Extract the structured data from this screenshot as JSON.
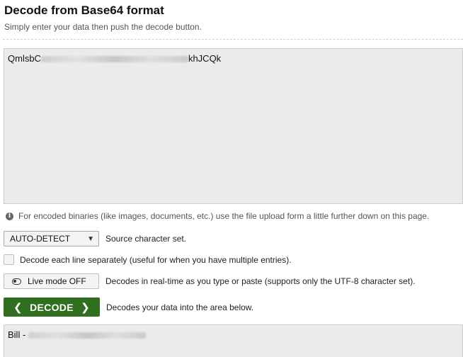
{
  "header": {
    "title": "Decode from Base64 format",
    "subtitle": "Simply enter your data then push the decode button."
  },
  "input": {
    "visible_start": "QmlsbC",
    "visible_end": "khJCQk"
  },
  "info": {
    "icon": "info-icon",
    "text": "For encoded binaries (like images, documents, etc.) use the file upload form a little further down on this page."
  },
  "charset": {
    "selected": "AUTO-DETECT",
    "label": "Source character set."
  },
  "each_line": {
    "checked": false,
    "label": "Decode each line separately (useful for when you have multiple entries)."
  },
  "live_mode": {
    "button_label": "Live mode OFF",
    "description": "Decodes in real-time as you type or paste (supports only the UTF-8 character set)."
  },
  "decode": {
    "button_label": "DECODE",
    "description": "Decodes your data into the area below."
  },
  "output": {
    "visible_start": "Bill -"
  },
  "colors": {
    "decode_button": "#2f6f1f",
    "textarea_bg": "#ebebeb"
  }
}
